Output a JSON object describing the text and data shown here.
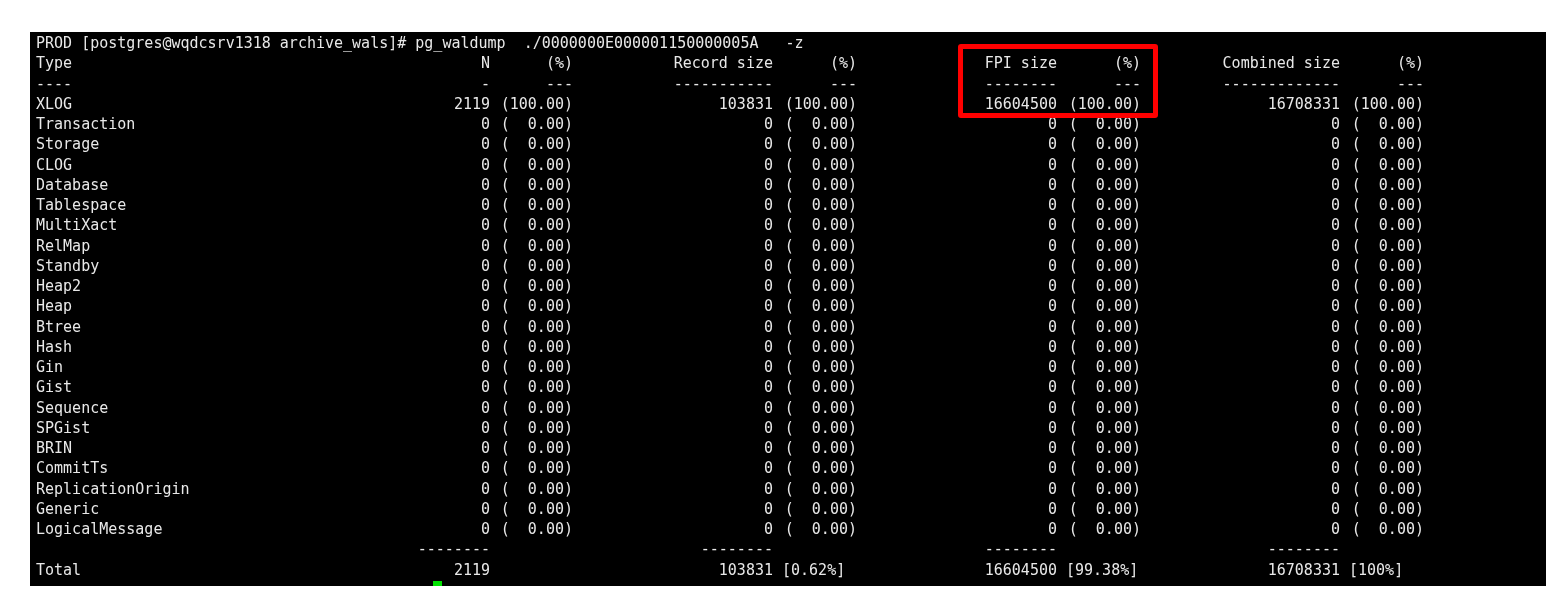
{
  "terminal": {
    "command_line": "PROD [postgres@wqdcsrv1318 archive_wals]# pg_waldump  ./0000000E000001150000005A   -z",
    "header": [
      "Type",
      "N",
      "(%)",
      "Record size",
      "(%)",
      "FPI size",
      "(%)",
      "Combined size",
      "(%)"
    ],
    "header_separator": [
      "----",
      "-",
      "---",
      "-----------",
      "---",
      "--------",
      "---",
      "-------------",
      "---"
    ],
    "rows": [
      {
        "cells": [
          "XLOG",
          "2119",
          "(100.00)",
          "103831",
          "(100.00)",
          "16604500",
          "(100.00)",
          "16708331",
          "(100.00)"
        ]
      },
      {
        "cells": [
          "Transaction",
          "0",
          "(  0.00)",
          "0",
          "(  0.00)",
          "0",
          "(  0.00)",
          "0",
          "(  0.00)"
        ]
      },
      {
        "cells": [
          "Storage",
          "0",
          "(  0.00)",
          "0",
          "(  0.00)",
          "0",
          "(  0.00)",
          "0",
          "(  0.00)"
        ]
      },
      {
        "cells": [
          "CLOG",
          "0",
          "(  0.00)",
          "0",
          "(  0.00)",
          "0",
          "(  0.00)",
          "0",
          "(  0.00)"
        ]
      },
      {
        "cells": [
          "Database",
          "0",
          "(  0.00)",
          "0",
          "(  0.00)",
          "0",
          "(  0.00)",
          "0",
          "(  0.00)"
        ]
      },
      {
        "cells": [
          "Tablespace",
          "0",
          "(  0.00)",
          "0",
          "(  0.00)",
          "0",
          "(  0.00)",
          "0",
          "(  0.00)"
        ]
      },
      {
        "cells": [
          "MultiXact",
          "0",
          "(  0.00)",
          "0",
          "(  0.00)",
          "0",
          "(  0.00)",
          "0",
          "(  0.00)"
        ]
      },
      {
        "cells": [
          "RelMap",
          "0",
          "(  0.00)",
          "0",
          "(  0.00)",
          "0",
          "(  0.00)",
          "0",
          "(  0.00)"
        ]
      },
      {
        "cells": [
          "Standby",
          "0",
          "(  0.00)",
          "0",
          "(  0.00)",
          "0",
          "(  0.00)",
          "0",
          "(  0.00)"
        ]
      },
      {
        "cells": [
          "Heap2",
          "0",
          "(  0.00)",
          "0",
          "(  0.00)",
          "0",
          "(  0.00)",
          "0",
          "(  0.00)"
        ]
      },
      {
        "cells": [
          "Heap",
          "0",
          "(  0.00)",
          "0",
          "(  0.00)",
          "0",
          "(  0.00)",
          "0",
          "(  0.00)"
        ]
      },
      {
        "cells": [
          "Btree",
          "0",
          "(  0.00)",
          "0",
          "(  0.00)",
          "0",
          "(  0.00)",
          "0",
          "(  0.00)"
        ]
      },
      {
        "cells": [
          "Hash",
          "0",
          "(  0.00)",
          "0",
          "(  0.00)",
          "0",
          "(  0.00)",
          "0",
          "(  0.00)"
        ]
      },
      {
        "cells": [
          "Gin",
          "0",
          "(  0.00)",
          "0",
          "(  0.00)",
          "0",
          "(  0.00)",
          "0",
          "(  0.00)"
        ]
      },
      {
        "cells": [
          "Gist",
          "0",
          "(  0.00)",
          "0",
          "(  0.00)",
          "0",
          "(  0.00)",
          "0",
          "(  0.00)"
        ]
      },
      {
        "cells": [
          "Sequence",
          "0",
          "(  0.00)",
          "0",
          "(  0.00)",
          "0",
          "(  0.00)",
          "0",
          "(  0.00)"
        ]
      },
      {
        "cells": [
          "SPGist",
          "0",
          "(  0.00)",
          "0",
          "(  0.00)",
          "0",
          "(  0.00)",
          "0",
          "(  0.00)"
        ]
      },
      {
        "cells": [
          "BRIN",
          "0",
          "(  0.00)",
          "0",
          "(  0.00)",
          "0",
          "(  0.00)",
          "0",
          "(  0.00)"
        ]
      },
      {
        "cells": [
          "CommitTs",
          "0",
          "(  0.00)",
          "0",
          "(  0.00)",
          "0",
          "(  0.00)",
          "0",
          "(  0.00)"
        ]
      },
      {
        "cells": [
          "ReplicationOrigin",
          "0",
          "(  0.00)",
          "0",
          "(  0.00)",
          "0",
          "(  0.00)",
          "0",
          "(  0.00)"
        ]
      },
      {
        "cells": [
          "Generic",
          "0",
          "(  0.00)",
          "0",
          "(  0.00)",
          "0",
          "(  0.00)",
          "0",
          "(  0.00)"
        ]
      },
      {
        "cells": [
          "LogicalMessage",
          "0",
          "(  0.00)",
          "0",
          "(  0.00)",
          "0",
          "(  0.00)",
          "0",
          "(  0.00)"
        ]
      }
    ],
    "total_separator": [
      "--------",
      "--------",
      "--------",
      "--------"
    ],
    "total": {
      "label": "Total",
      "n": "2119",
      "record_size": "103831",
      "record_pct": "[0.62%]",
      "fpi_size": "16604500",
      "fpi_pct": "[99.38%]",
      "combined_size": "16708331",
      "combined_pct": "[100%]"
    }
  }
}
